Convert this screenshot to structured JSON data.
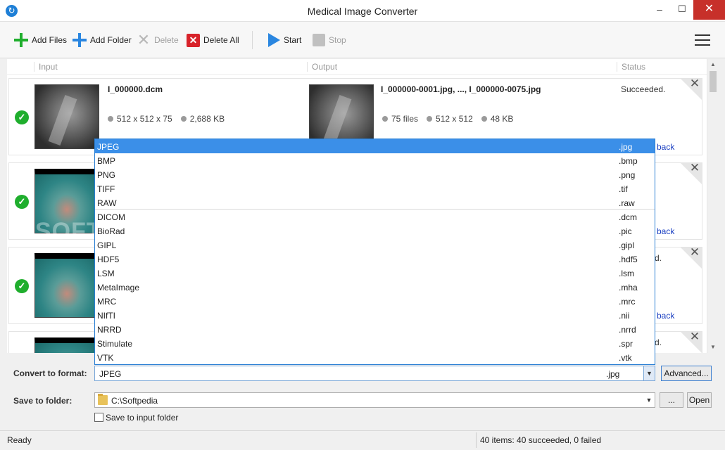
{
  "window": {
    "title": "Medical Image Converter",
    "minimize": "–",
    "maximize": "☐",
    "close": "✕"
  },
  "toolbar": {
    "add_files": "Add Files",
    "add_folder": "Add Folder",
    "delete": "Delete",
    "delete_all": "Delete All",
    "start": "Start",
    "stop": "Stop"
  },
  "columns": {
    "input": "Input",
    "output": "Output",
    "status": "Status"
  },
  "items": [
    {
      "input_name": "I_000000.dcm",
      "input_meta": [
        "512 x 512 x 75",
        "2,688 KB"
      ],
      "output_name": "I_000000-0001.jpg, ..., I_000000-0075.jpg",
      "output_meta": [
        "75 files",
        "512 x 512",
        "48 KB"
      ],
      "status": "Succeeded.",
      "feedback": "back"
    },
    {
      "status": "",
      "feedback": "back"
    },
    {
      "status": "d.",
      "feedback": "back"
    },
    {
      "status": "d."
    }
  ],
  "watermark": "SOFTPEDIA",
  "format_dropdown": {
    "options": [
      {
        "name": "JPEG",
        "ext": ".jpg"
      },
      {
        "name": "BMP",
        "ext": ".bmp"
      },
      {
        "name": "PNG",
        "ext": ".png"
      },
      {
        "name": "TIFF",
        "ext": ".tif"
      },
      {
        "name": "RAW",
        "ext": ".raw"
      },
      {
        "name": "DICOM",
        "ext": ".dcm"
      },
      {
        "name": "BioRad",
        "ext": ".pic"
      },
      {
        "name": "GIPL",
        "ext": ".gipl"
      },
      {
        "name": "HDF5",
        "ext": ".hdf5"
      },
      {
        "name": "LSM",
        "ext": ".lsm"
      },
      {
        "name": "MetaImage",
        "ext": ".mha"
      },
      {
        "name": "MRC",
        "ext": ".mrc"
      },
      {
        "name": "NIfTI",
        "ext": ".nii"
      },
      {
        "name": "NRRD",
        "ext": ".nrrd"
      },
      {
        "name": "Stimulate",
        "ext": ".spr"
      },
      {
        "name": "VTK",
        "ext": ".vtk"
      }
    ],
    "selected_index": 0
  },
  "convert": {
    "label": "Convert to format:",
    "value": "JPEG",
    "ext": ".jpg",
    "advanced": "Advanced..."
  },
  "save": {
    "label": "Save to folder:",
    "path": "C:\\Softpedia",
    "browse": "...",
    "open": "Open",
    "checkbox_label": "Save to input folder",
    "checked": false
  },
  "statusbar": {
    "left": "Ready",
    "right": "40 items: 40 succeeded, 0 failed"
  },
  "colors": {
    "accent": "#3b8fe8",
    "success": "#1fae2d",
    "danger": "#d8232a",
    "close_button": "#c7302a"
  }
}
